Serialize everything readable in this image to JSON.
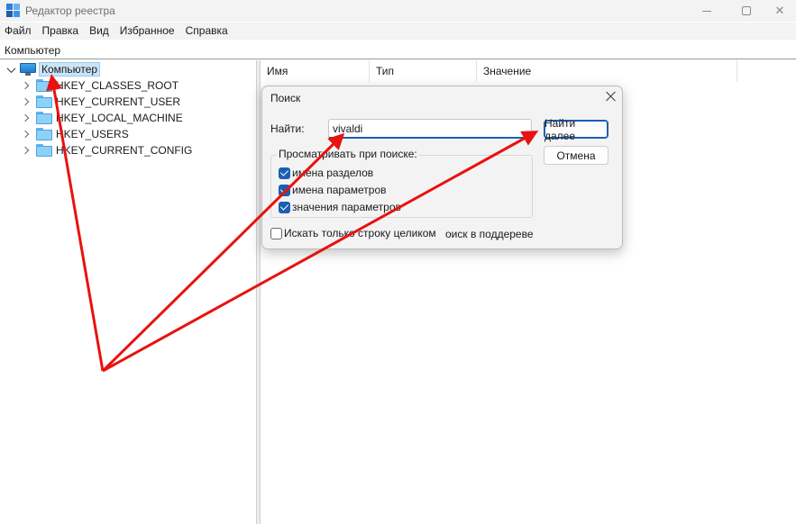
{
  "window": {
    "title": "Редактор реестра",
    "minimize_icon": "minimize-icon",
    "maximize_icon": "maximize-icon",
    "close_icon": "close-icon"
  },
  "menu": {
    "items": [
      "Файл",
      "Правка",
      "Вид",
      "Избранное",
      "Справка"
    ]
  },
  "address": {
    "path": "Компьютер"
  },
  "tree": {
    "root": "Компьютер",
    "children": [
      "HKEY_CLASSES_ROOT",
      "HKEY_CURRENT_USER",
      "HKEY_LOCAL_MACHINE",
      "HKEY_USERS",
      "HKEY_CURRENT_CONFIG"
    ]
  },
  "list": {
    "columns": [
      "Имя",
      "Тип",
      "Значение"
    ]
  },
  "find_dialog": {
    "title": "Поиск",
    "find_label": "Найти:",
    "find_value": "vivaldi",
    "find_next": "Найти далее",
    "cancel": "Отмена",
    "look_at_label": "Просматривать при поиске:",
    "options": {
      "keys": "имена разделов",
      "values": "имена параметров",
      "data": "значения параметров"
    },
    "match_whole": "Искать только строку целиком",
    "subtree_text": "оиск в поддереве"
  },
  "colors": {
    "accent": "#1a5fb4",
    "annotation_arrow": "#e8120f",
    "selection": "#cce4f7"
  }
}
